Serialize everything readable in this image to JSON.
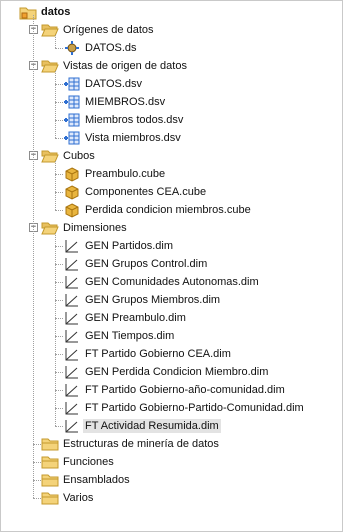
{
  "tree": {
    "root": {
      "label": "datos",
      "icon": "project-folder-icon"
    },
    "sections": [
      {
        "label": "Orígenes de datos",
        "icon": "folder-open-icon",
        "items": [
          {
            "label": "DATOS.ds",
            "icon": "datasource-icon"
          }
        ]
      },
      {
        "label": "Vistas de origen de datos",
        "icon": "folder-open-icon",
        "items": [
          {
            "label": "DATOS.dsv",
            "icon": "datasource-view-icon"
          },
          {
            "label": "MIEMBROS.dsv",
            "icon": "datasource-view-icon"
          },
          {
            "label": "Miembros todos.dsv",
            "icon": "datasource-view-icon"
          },
          {
            "label": "Vista miembros.dsv",
            "icon": "datasource-view-icon"
          }
        ]
      },
      {
        "label": "Cubos",
        "icon": "folder-open-icon",
        "items": [
          {
            "label": "Preambulo.cube",
            "icon": "cube-icon"
          },
          {
            "label": "Componentes CEA.cube",
            "icon": "cube-icon"
          },
          {
            "label": "Perdida condicion miembros.cube",
            "icon": "cube-icon"
          }
        ]
      },
      {
        "label": "Dimensiones",
        "icon": "folder-open-icon",
        "items": [
          {
            "label": "GEN Partidos.dim",
            "icon": "dimension-icon"
          },
          {
            "label": "GEN Grupos Control.dim",
            "icon": "dimension-icon"
          },
          {
            "label": "GEN Comunidades Autonomas.dim",
            "icon": "dimension-icon"
          },
          {
            "label": "GEN Grupos Miembros.dim",
            "icon": "dimension-icon"
          },
          {
            "label": "GEN Preambulo.dim",
            "icon": "dimension-icon"
          },
          {
            "label": "GEN Tiempos.dim",
            "icon": "dimension-icon"
          },
          {
            "label": "FT Partido Gobierno CEA.dim",
            "icon": "dimension-icon"
          },
          {
            "label": "GEN Perdida Condicion Miembro.dim",
            "icon": "dimension-icon"
          },
          {
            "label": "FT Partido Gobierno-año-comunidad.dim",
            "icon": "dimension-icon"
          },
          {
            "label": "FT Partido Gobierno-Partido-Comunidad.dim",
            "icon": "dimension-icon"
          },
          {
            "label": "FT Actividad Resumida.dim",
            "icon": "dimension-icon",
            "selected": true
          }
        ]
      },
      {
        "label": "Estructuras de minería de datos",
        "icon": "folder-closed-icon",
        "items": []
      },
      {
        "label": "Funciones",
        "icon": "folder-closed-icon",
        "items": []
      },
      {
        "label": "Ensamblados",
        "icon": "folder-closed-icon",
        "items": []
      },
      {
        "label": "Varios",
        "icon": "folder-closed-icon",
        "items": []
      }
    ]
  },
  "colors": {
    "folder_fill": "#f4d37a",
    "folder_stroke": "#c49a2c",
    "cube_fill": "#e9b53f",
    "dsv_blue": "#2f6fd1",
    "selection_bg": "#e3e3e3"
  }
}
